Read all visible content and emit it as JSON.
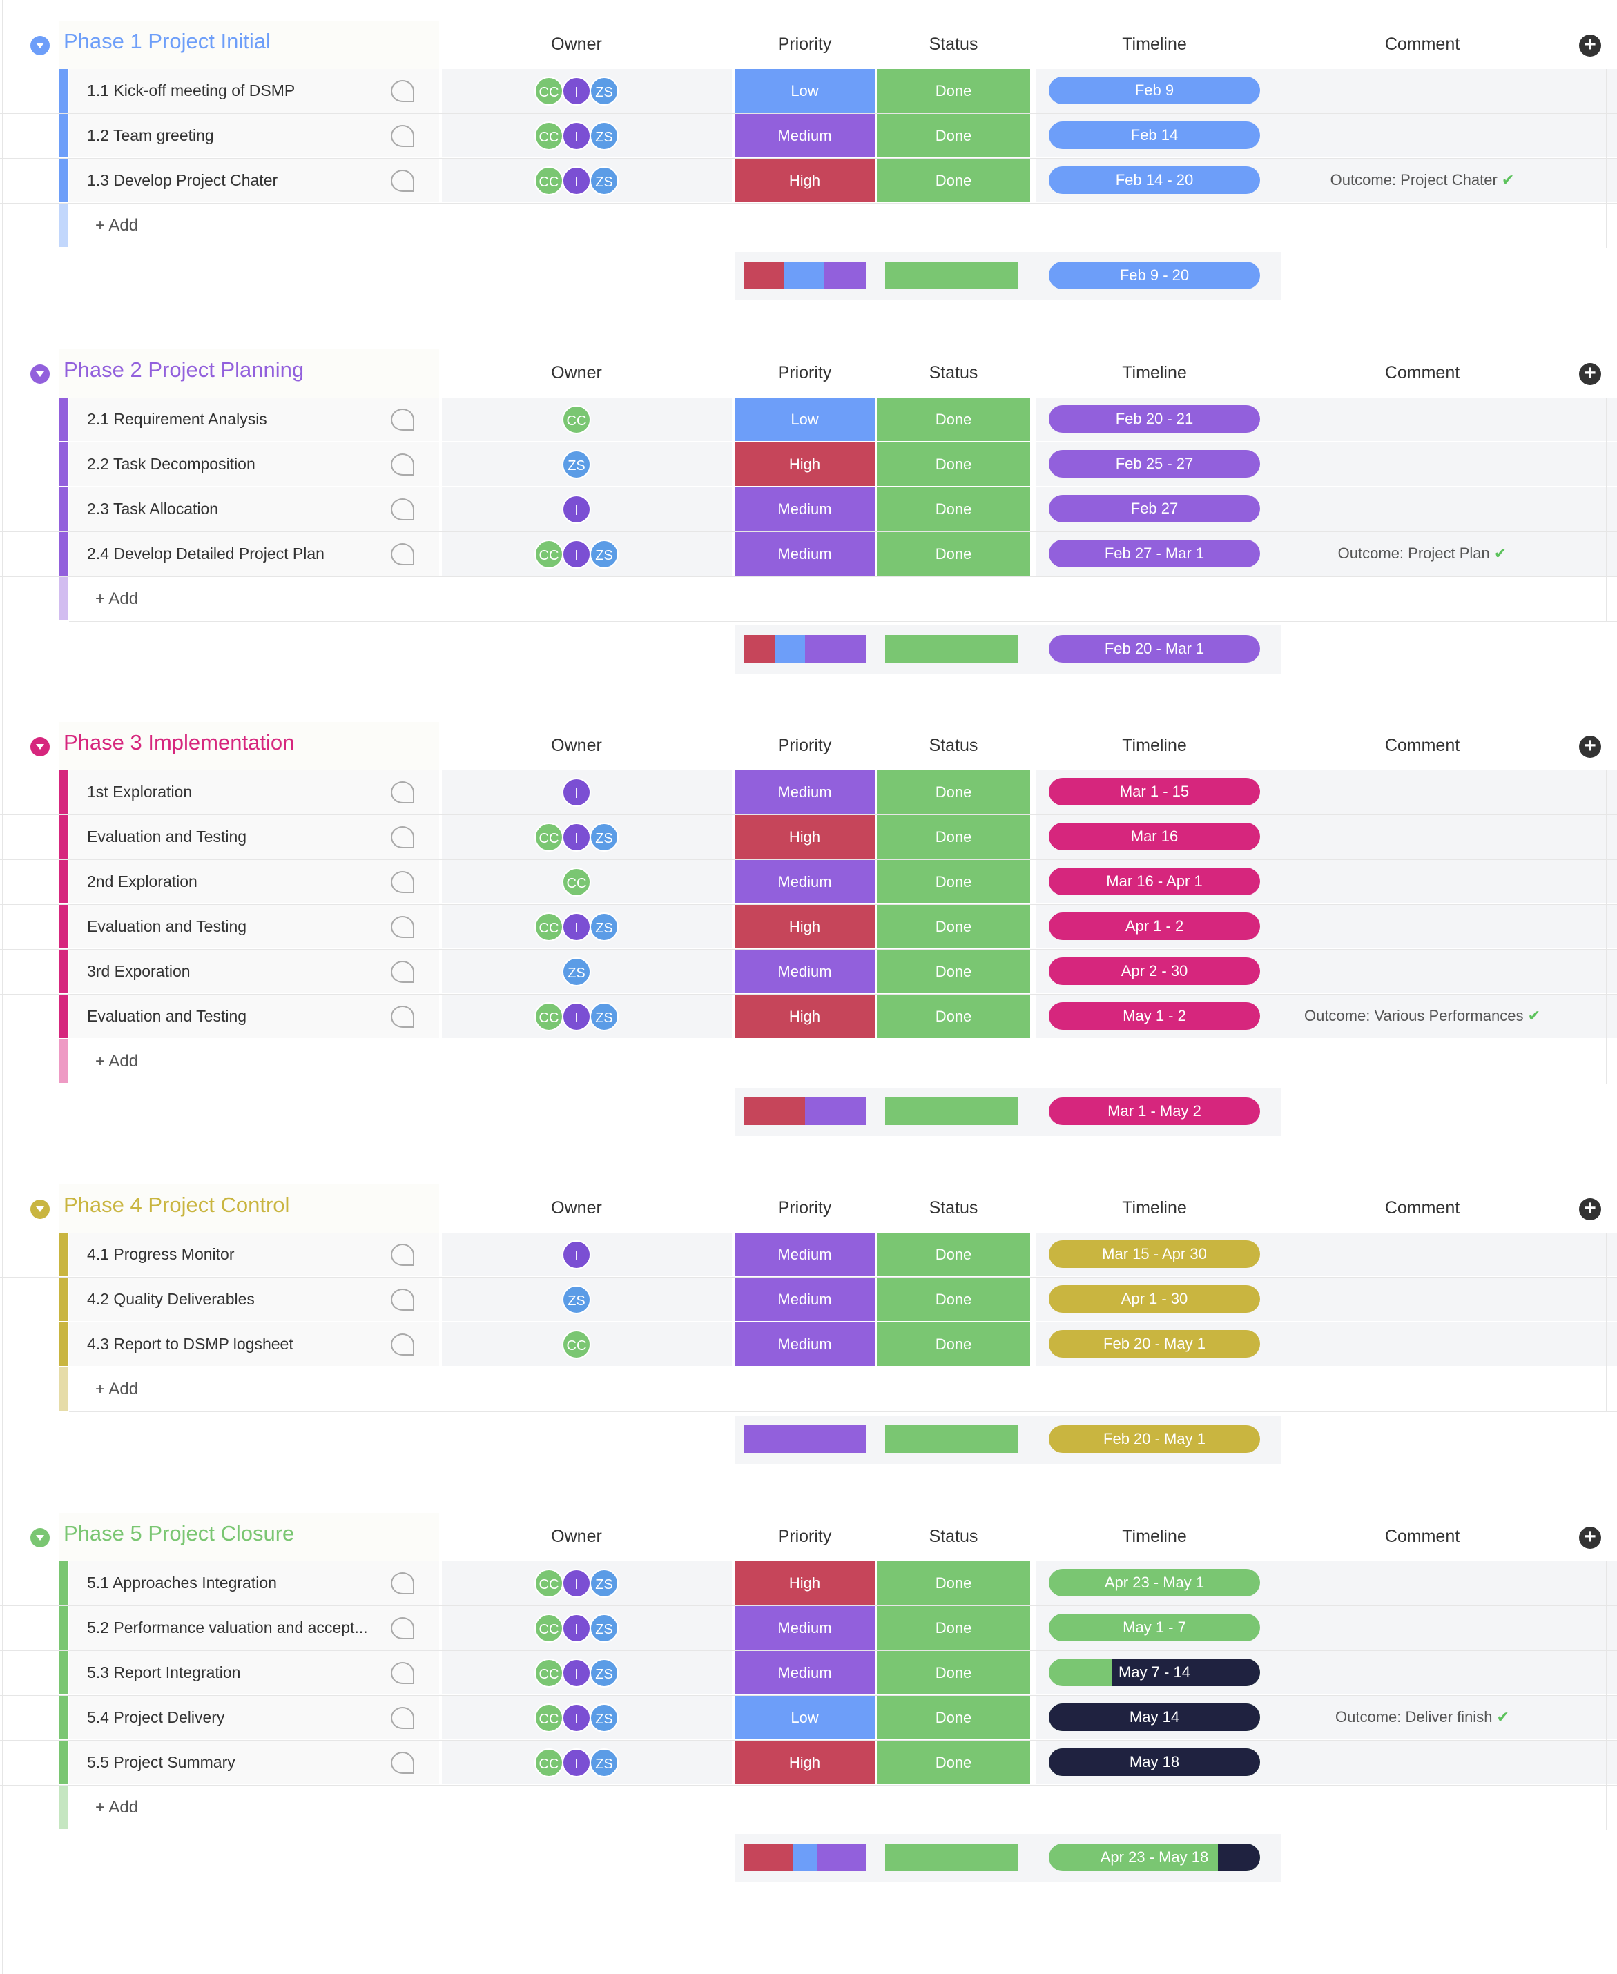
{
  "columns": {
    "owner": "Owner",
    "priority": "Priority",
    "status": "Status",
    "timeline": "Timeline",
    "comment": "Comment"
  },
  "add_label": "+ Add",
  "colors": {
    "low": "#6d9ef9",
    "medium": "#9260dc",
    "high": "#c6455a",
    "done": "#7ac672",
    "dark": "#1f2240"
  },
  "owners": {
    "CC": {
      "initials": "CC",
      "color": "#7ac672"
    },
    "I": {
      "initials": "I",
      "color": "#7b4fd3"
    },
    "ZS": {
      "initials": "ZS",
      "color": "#5b9ce6"
    }
  },
  "groups": [
    {
      "title": "Phase 1 Project Initial",
      "color": "#6d9ef9",
      "light": "#c2d7fc",
      "rows": [
        {
          "name": "1.1 Kick-off meeting of DSMP",
          "owners": [
            "CC",
            "I",
            "ZS"
          ],
          "priority": "Low",
          "status": "Done",
          "timeline": "Feb 9",
          "comment": ""
        },
        {
          "name": "1.2 Team greeting",
          "owners": [
            "CC",
            "I",
            "ZS"
          ],
          "priority": "Medium",
          "status": "Done",
          "timeline": "Feb 14",
          "comment": ""
        },
        {
          "name": "1.3 Develop Project Chater",
          "owners": [
            "CC",
            "I",
            "ZS"
          ],
          "priority": "High",
          "status": "Done",
          "timeline": "Feb 14 - 20",
          "comment": "Outcome: Project Chater"
        }
      ],
      "summary": {
        "priority_mix": [
          {
            "p": "High",
            "pct": 33
          },
          {
            "p": "Low",
            "pct": 33
          },
          {
            "p": "Medium",
            "pct": 34
          }
        ],
        "timeline": "Feb 9 - 20"
      }
    },
    {
      "title": "Phase 2 Project Planning",
      "color": "#9260dc",
      "light": "#d2bdf0",
      "rows": [
        {
          "name": "2.1 Requirement Analysis",
          "owners": [
            "CC"
          ],
          "priority": "Low",
          "status": "Done",
          "timeline": "Feb 20 - 21",
          "comment": ""
        },
        {
          "name": "2.2 Task Decomposition",
          "owners": [
            "ZS"
          ],
          "priority": "High",
          "status": "Done",
          "timeline": "Feb 25 - 27",
          "comment": ""
        },
        {
          "name": "2.3 Task Allocation",
          "owners": [
            "I"
          ],
          "priority": "Medium",
          "status": "Done",
          "timeline": "Feb 27",
          "comment": ""
        },
        {
          "name": "2.4 Develop Detailed Project Plan",
          "owners": [
            "CC",
            "I",
            "ZS"
          ],
          "priority": "Medium",
          "status": "Done",
          "timeline": "Feb 27 - Mar 1",
          "comment": "Outcome: Project Plan"
        }
      ],
      "summary": {
        "priority_mix": [
          {
            "p": "High",
            "pct": 25
          },
          {
            "p": "Low",
            "pct": 25
          },
          {
            "p": "Medium",
            "pct": 50
          }
        ],
        "timeline": "Feb 20 - Mar 1"
      }
    },
    {
      "title": "Phase 3 Implementation",
      "color": "#d6267d",
      "light": "#ee9ac4",
      "rows": [
        {
          "name": "1st Exploration",
          "owners": [
            "I"
          ],
          "priority": "Medium",
          "status": "Done",
          "timeline": "Mar 1 - 15",
          "comment": ""
        },
        {
          "name": "Evaluation and Testing",
          "owners": [
            "CC",
            "I",
            "ZS"
          ],
          "priority": "High",
          "status": "Done",
          "timeline": "Mar 16",
          "comment": ""
        },
        {
          "name": "2nd Exploration",
          "owners": [
            "CC"
          ],
          "priority": "Medium",
          "status": "Done",
          "timeline": "Mar 16 - Apr 1",
          "comment": ""
        },
        {
          "name": "Evaluation and Testing",
          "owners": [
            "CC",
            "I",
            "ZS"
          ],
          "priority": "High",
          "status": "Done",
          "timeline": "Apr 1 - 2",
          "comment": ""
        },
        {
          "name": "3rd Exporation",
          "owners": [
            "ZS"
          ],
          "priority": "Medium",
          "status": "Done",
          "timeline": "Apr 2 - 30",
          "comment": ""
        },
        {
          "name": "Evaluation and Testing",
          "owners": [
            "CC",
            "I",
            "ZS"
          ],
          "priority": "High",
          "status": "Done",
          "timeline": "May 1 - 2",
          "comment": "Outcome: Various Performances"
        }
      ],
      "summary": {
        "priority_mix": [
          {
            "p": "High",
            "pct": 50
          },
          {
            "p": "Medium",
            "pct": 50
          }
        ],
        "timeline": "Mar 1 - May 2"
      }
    },
    {
      "title": "Phase 4 Project Control",
      "color": "#c9b540",
      "light": "#e6dca8",
      "rows": [
        {
          "name": "4.1 Progress Monitor",
          "owners": [
            "I"
          ],
          "priority": "Medium",
          "status": "Done",
          "timeline": "Mar 15 - Apr 30",
          "comment": ""
        },
        {
          "name": "4.2 Quality Deliverables",
          "owners": [
            "ZS"
          ],
          "priority": "Medium",
          "status": "Done",
          "timeline": "Apr 1 - 30",
          "comment": ""
        },
        {
          "name": "4.3 Report to DSMP logsheet",
          "owners": [
            "CC"
          ],
          "priority": "Medium",
          "status": "Done",
          "timeline": "Feb 20 - May 1",
          "comment": ""
        }
      ],
      "summary": {
        "priority_mix": [
          {
            "p": "Medium",
            "pct": 100
          }
        ],
        "timeline": "Feb 20 - May 1"
      }
    },
    {
      "title": "Phase 5 Project Closure",
      "color": "#7ac672",
      "light": "#c5e6c1",
      "rows": [
        {
          "name": "5.1 Approaches Integration",
          "owners": [
            "CC",
            "I",
            "ZS"
          ],
          "priority": "High",
          "status": "Done",
          "timeline": "Apr 23 - May 1",
          "dark_pct": 0,
          "comment": ""
        },
        {
          "name": "5.2 Performance valuation and accept...",
          "owners": [
            "CC",
            "I",
            "ZS"
          ],
          "priority": "Medium",
          "status": "Done",
          "timeline": "May 1 - 7",
          "dark_pct": 0,
          "comment": ""
        },
        {
          "name": "5.3 Report Integration",
          "owners": [
            "CC",
            "I",
            "ZS"
          ],
          "priority": "Medium",
          "status": "Done",
          "timeline": "May 7 - 14",
          "dark_pct": 70,
          "comment": ""
        },
        {
          "name": "5.4 Project Delivery",
          "owners": [
            "CC",
            "I",
            "ZS"
          ],
          "priority": "Low",
          "status": "Done",
          "timeline": "May 14",
          "dark_pct": 100,
          "comment": "Outcome: Deliver finish"
        },
        {
          "name": "5.5 Project Summary",
          "owners": [
            "CC",
            "I",
            "ZS"
          ],
          "priority": "High",
          "status": "Done",
          "timeline": "May 18",
          "dark_pct": 100,
          "comment": ""
        }
      ],
      "summary": {
        "priority_mix": [
          {
            "p": "High",
            "pct": 40
          },
          {
            "p": "Low",
            "pct": 20
          },
          {
            "p": "Medium",
            "pct": 40
          }
        ],
        "timeline": "Apr 23 - May 18",
        "dark_pct": 20
      }
    }
  ]
}
